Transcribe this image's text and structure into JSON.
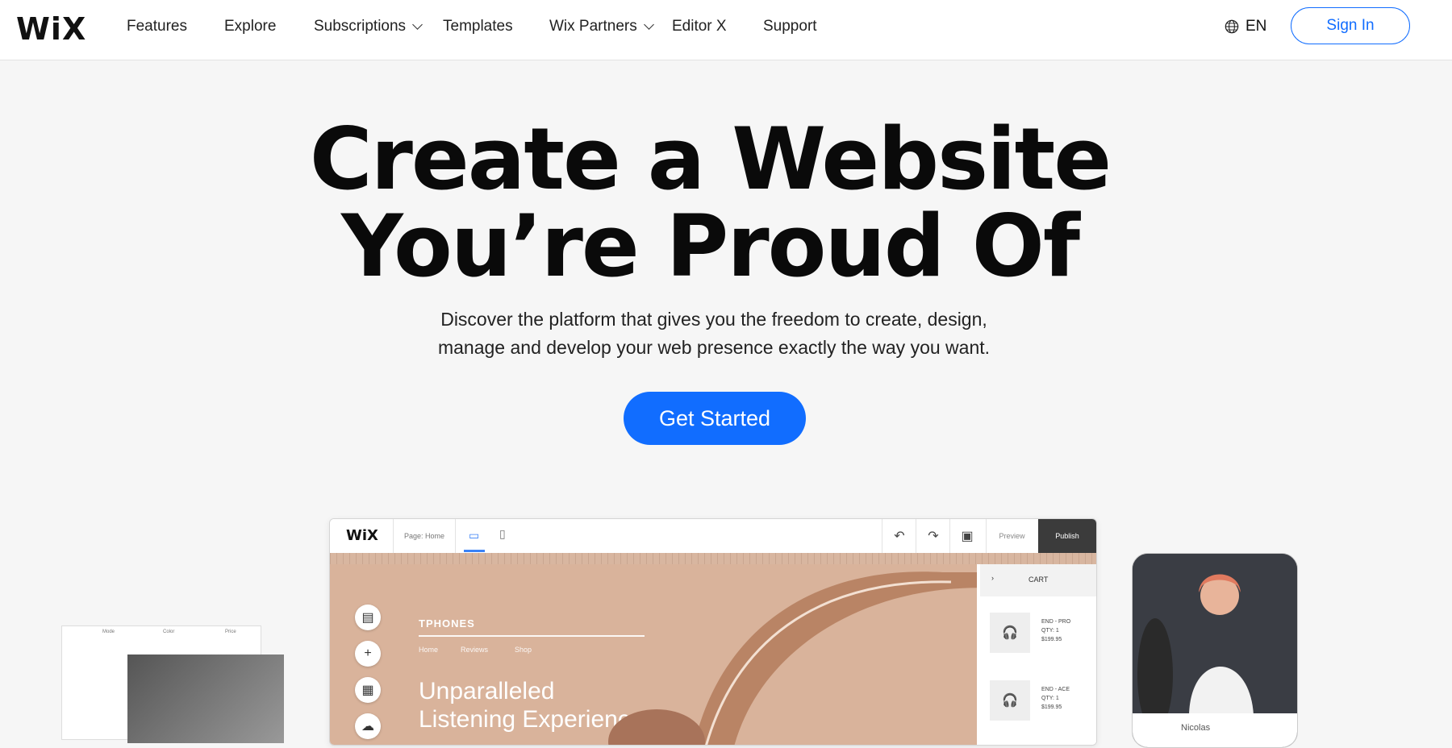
{
  "header": {
    "logo": "WiX",
    "nav": [
      {
        "label": "Features"
      },
      {
        "label": "Explore"
      },
      {
        "label": "Subscriptions"
      },
      {
        "label": "Templates"
      },
      {
        "label": "Wix Partners"
      },
      {
        "label": "Editor X"
      },
      {
        "label": "Support"
      }
    ],
    "language": "EN",
    "signin": "Sign In"
  },
  "hero": {
    "title_line1": "Create a Website",
    "title_line2": "You’re Proud Of",
    "subtitle_line1": "Discover the platform that gives you the freedom to create, design,",
    "subtitle_line2": "manage and develop your web presence exactly the way you want.",
    "cta": "Get Started"
  },
  "editor": {
    "logo": "WiX",
    "page_selector": "Page: Home",
    "preview": "Preview",
    "publish": "Publish",
    "site": {
      "brand": "TPHONES",
      "menu": [
        "Home",
        "Reviews",
        "Shop"
      ],
      "headline_line1": "Unparalleled",
      "headline_line2": "Listening Experience"
    },
    "cart": {
      "title": "CART",
      "items": [
        {
          "name": "END - PRO",
          "qty": "QTY: 1",
          "price": "$199.95"
        },
        {
          "name": "END - ACE",
          "qty": "QTY: 1",
          "price": "$199.95"
        }
      ]
    }
  },
  "sheet": {
    "headers": [
      "Mode",
      "Color",
      "Price"
    ]
  },
  "phone": {
    "name": "Nicolas"
  },
  "colors": {
    "accent": "#116dff",
    "background": "#f6f6f6"
  }
}
